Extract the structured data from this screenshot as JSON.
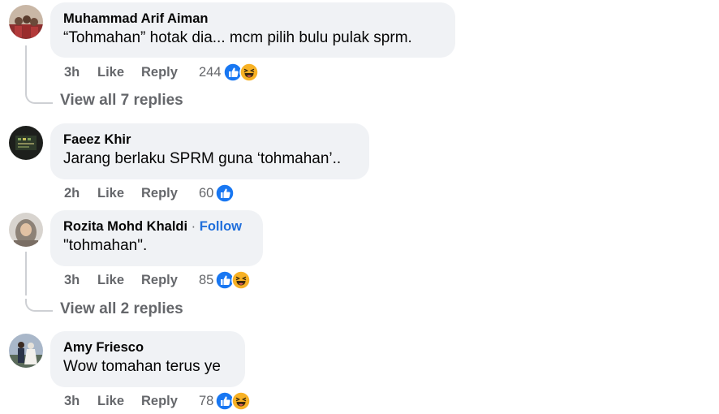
{
  "comments": [
    {
      "author": "Muhammad Arif Aiman",
      "text": "“Tohmahan” hotak dia... mcm pilih bulu pulak sprm.",
      "time": "3h",
      "like_label": "Like",
      "reply_label": "Reply",
      "reaction_count": "244",
      "reactions": [
        "like-icon",
        "haha-icon"
      ],
      "view_replies": "View all 7 replies"
    },
    {
      "author": "Faeez Khir",
      "text": "Jarang berlaku SPRM guna ‘tohmahan’..",
      "time": "2h",
      "like_label": "Like",
      "reply_label": "Reply",
      "reaction_count": "60",
      "reactions": [
        "like-icon"
      ]
    },
    {
      "author": "Rozita Mohd Khaldi",
      "follow_sep": " · ",
      "follow_label": "Follow",
      "text": "\"tohmahan\".",
      "time": "3h",
      "like_label": "Like",
      "reply_label": "Reply",
      "reaction_count": "85",
      "reactions": [
        "like-icon",
        "haha-icon"
      ],
      "view_replies": "View all 2 replies"
    },
    {
      "author": "Amy Friesco",
      "text": "Wow tomahan terus ye",
      "time": "3h",
      "like_label": "Like",
      "reply_label": "Reply",
      "reaction_count": "78",
      "reactions": [
        "like-icon",
        "haha-icon"
      ]
    }
  ],
  "colors": {
    "bubble": "#f0f2f5",
    "meta_text": "#65676b",
    "like_blue": "#1877f2",
    "follow_blue": "#216fdb",
    "haha_yellow": "#f7b125"
  }
}
